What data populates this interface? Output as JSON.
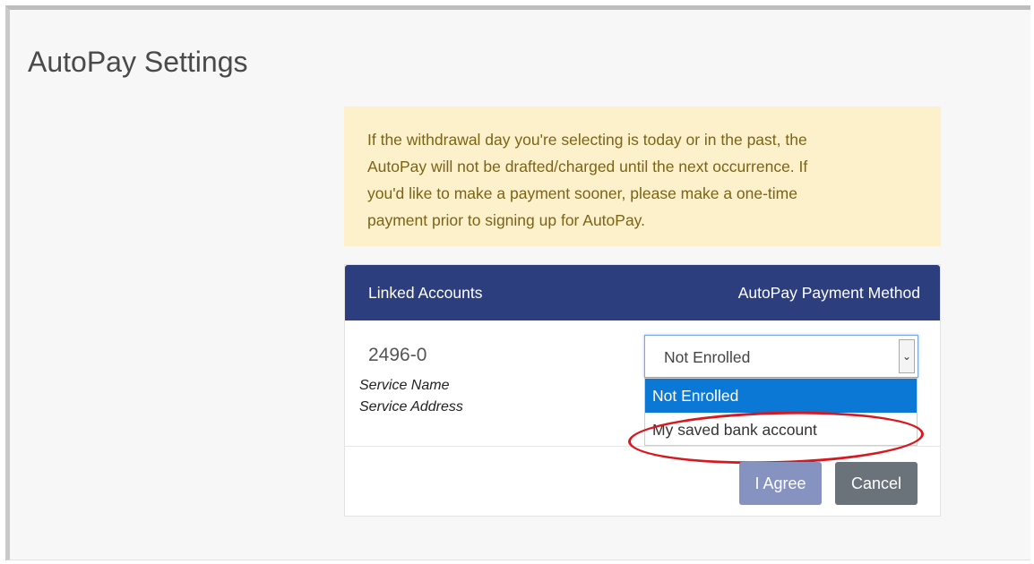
{
  "page": {
    "title": "AutoPay Settings"
  },
  "alert": {
    "lines": [
      "If the withdrawal day you're selecting is today or in the past, the",
      "AutoPay will not be drafted/charged until the next occurrence. If",
      "you'd like to make a payment sooner, please make a one-time",
      "payment prior to signing up for AutoPay."
    ]
  },
  "table": {
    "header_left": "Linked Accounts",
    "header_right": "AutoPay Payment Method",
    "account": {
      "number": "2496-0",
      "service_name": "Service Name",
      "service_address": "Service Address"
    }
  },
  "payment_method": {
    "selected": "Not Enrolled",
    "options": [
      "Not Enrolled",
      "My saved bank account"
    ],
    "arrow_icon": "chevron-down-icon"
  },
  "buttons": {
    "agree": "I Agree",
    "cancel": "Cancel"
  },
  "colors": {
    "header_bg": "#2d3e7e",
    "alert_bg": "#fdf1cc",
    "alert_text": "#7c6416",
    "option_selected_bg": "#0a78d4",
    "agree_bg": "#8692c0",
    "cancel_bg": "#6a737a",
    "annotation_ring": "#d7191f"
  }
}
